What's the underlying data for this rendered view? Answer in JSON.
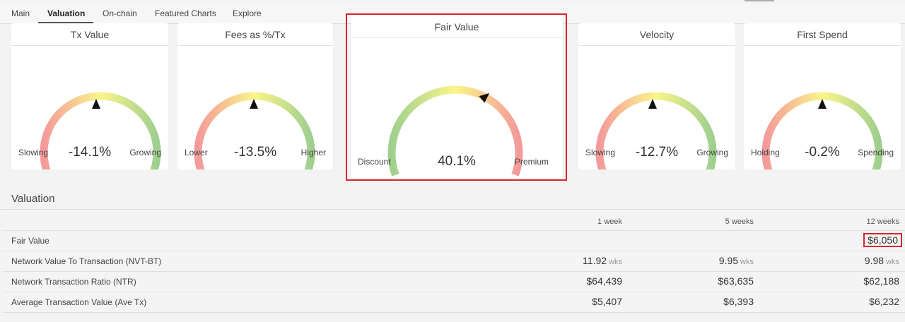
{
  "tabs": [
    {
      "label": "Main"
    },
    {
      "label": "Valuation",
      "active": true
    },
    {
      "label": "On-chain"
    },
    {
      "label": "Featured Charts"
    },
    {
      "label": "Explore"
    }
  ],
  "gauges": [
    {
      "title": "Tx Value",
      "left_label": "Slowing",
      "right_label": "Growing",
      "value": "-14.1%",
      "gradient": "red-yellow-green"
    },
    {
      "title": "Fees as %/Tx",
      "left_label": "Lower",
      "right_label": "Higher",
      "value": "-13.5%",
      "gradient": "red-yellow-green"
    },
    {
      "title": "Fair Value",
      "left_label": "Discount",
      "right_label": "Premium",
      "value": "40.1%",
      "gradient": "green-yellow-red",
      "highlighted": true
    },
    {
      "title": "Velocity",
      "left_label": "Slowing",
      "right_label": "Growing",
      "value": "-12.7%",
      "gradient": "red-yellow-green"
    },
    {
      "title": "First Spend",
      "left_label": "Holding",
      "right_label": "Spending",
      "value": "-0.2%",
      "gradient": "red-yellow-green"
    }
  ],
  "valuation": {
    "section_title": "Valuation",
    "columns": [
      "1 week",
      "5 weeks",
      "12 weeks"
    ],
    "rows": [
      {
        "label": "Fair Value",
        "cells": [
          "",
          "",
          "$6,050"
        ]
      },
      {
        "label": "Network Value To Transaction (NVT-BT)",
        "cells": [
          "11.92",
          "9.95",
          "9.98"
        ],
        "unit": "wks"
      },
      {
        "label": "Network Transaction Ratio (NTR)",
        "cells": [
          "$64,439",
          "$63,635",
          "$62,188"
        ]
      },
      {
        "label": "Average Transaction Value (Ave Tx)",
        "cells": [
          "$5,407",
          "$6,393",
          "$6,232"
        ]
      }
    ]
  },
  "colors": {
    "highlight": "#d9262b",
    "gauge_red": "#f49a9a",
    "gauge_yellow": "#faf58a",
    "gauge_green": "#9fcf8e"
  }
}
